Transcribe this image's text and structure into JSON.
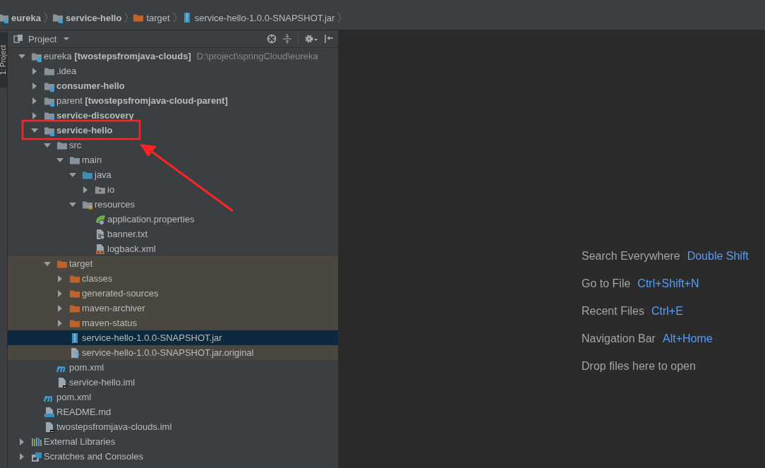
{
  "breadcrumbs": [
    {
      "label": "eureka",
      "kind": "module",
      "bold": true
    },
    {
      "label": "service-hello",
      "kind": "module",
      "bold": true
    },
    {
      "label": "target",
      "kind": "excluded-folder",
      "bold": false
    },
    {
      "label": "service-hello-1.0.0-SNAPSHOT.jar",
      "kind": "jar",
      "bold": false
    }
  ],
  "tool_stripe": {
    "label": "1: Project",
    "active": true
  },
  "project_panel": {
    "title": "Project",
    "tree": [
      {
        "label": "eureka **[twostepsfromjava-clouds]**",
        "path": "D:\\project\\springCloud\\eureka",
        "kind": "module",
        "bold": false,
        "expanded": true,
        "selected": false,
        "excluded": false,
        "children": [
          {
            "label": ".idea",
            "kind": "folder",
            "bold": false,
            "expanded": false,
            "selected": false,
            "excluded": false
          },
          {
            "label": "consumer-hello",
            "kind": "module",
            "bold": true,
            "expanded": false,
            "selected": false,
            "excluded": false
          },
          {
            "label": "parent **[twostepsfromjava-cloud-parent]**",
            "kind": "module",
            "bold": false,
            "expanded": false,
            "selected": false,
            "excluded": false
          },
          {
            "label": "service-discovery",
            "kind": "module",
            "bold": true,
            "expanded": false,
            "selected": false,
            "excluded": false
          },
          {
            "label": "service-hello",
            "kind": "module",
            "bold": true,
            "expanded": true,
            "selected": false,
            "excluded": false,
            "children": [
              {
                "label": "src",
                "kind": "folder",
                "bold": false,
                "expanded": true,
                "selected": false,
                "excluded": false,
                "children": [
                  {
                    "label": "main",
                    "kind": "folder",
                    "bold": false,
                    "expanded": true,
                    "selected": false,
                    "excluded": false,
                    "children": [
                      {
                        "label": "java",
                        "kind": "source-folder",
                        "bold": false,
                        "expanded": true,
                        "selected": false,
                        "excluded": false,
                        "children": [
                          {
                            "label": "io",
                            "kind": "package",
                            "bold": false,
                            "expanded": false,
                            "selected": false,
                            "excluded": false
                          }
                        ]
                      },
                      {
                        "label": "resources",
                        "kind": "resources-folder",
                        "bold": false,
                        "expanded": true,
                        "selected": false,
                        "excluded": false,
                        "children": [
                          {
                            "label": "application.properties",
                            "kind": "spring-file",
                            "bold": false,
                            "selected": false,
                            "excluded": false
                          },
                          {
                            "label": "banner.txt",
                            "kind": "text-file",
                            "bold": false,
                            "selected": false,
                            "excluded": false
                          },
                          {
                            "label": "logback.xml",
                            "kind": "xml-file",
                            "bold": false,
                            "selected": false,
                            "excluded": false
                          }
                        ]
                      }
                    ]
                  }
                ]
              },
              {
                "label": "target",
                "kind": "excluded-folder",
                "bold": false,
                "expanded": true,
                "selected": false,
                "excluded": true,
                "children": [
                  {
                    "label": "classes",
                    "kind": "excluded-folder",
                    "bold": false,
                    "expanded": false,
                    "selected": false,
                    "excluded": true
                  },
                  {
                    "label": "generated-sources",
                    "kind": "excluded-folder",
                    "bold": false,
                    "expanded": false,
                    "selected": false,
                    "excluded": true
                  },
                  {
                    "label": "maven-archiver",
                    "kind": "excluded-folder",
                    "bold": false,
                    "expanded": false,
                    "selected": false,
                    "excluded": true
                  },
                  {
                    "label": "maven-status",
                    "kind": "excluded-folder",
                    "bold": false,
                    "expanded": false,
                    "selected": false,
                    "excluded": true
                  },
                  {
                    "label": "service-hello-1.0.0-SNAPSHOT.jar",
                    "kind": "jar",
                    "bold": false,
                    "selected": true,
                    "excluded": false
                  },
                  {
                    "label": "service-hello-1.0.0-SNAPSHOT.jar.original",
                    "kind": "unknown-file",
                    "bold": false,
                    "selected": false,
                    "excluded": true
                  }
                ]
              },
              {
                "label": "pom.xml",
                "kind": "maven-file",
                "bold": false,
                "selected": false,
                "excluded": false
              },
              {
                "label": "service-hello.iml",
                "kind": "iml-file",
                "bold": false,
                "selected": false,
                "excluded": false
              }
            ]
          },
          {
            "label": "pom.xml",
            "kind": "maven-file",
            "bold": false,
            "selected": false,
            "excluded": false
          },
          {
            "label": "README.md",
            "kind": "markdown-file",
            "bold": false,
            "selected": false,
            "excluded": false
          },
          {
            "label": "twostepsfromjava-clouds.iml",
            "kind": "iml-file",
            "bold": false,
            "selected": false,
            "excluded": false
          }
        ]
      },
      {
        "label": "External Libraries",
        "kind": "libraries",
        "bold": false,
        "expanded": false,
        "selected": false,
        "excluded": false
      },
      {
        "label": "Scratches and Consoles",
        "kind": "scratches",
        "bold": false,
        "expanded": false,
        "selected": false,
        "excluded": false
      }
    ]
  },
  "editor_hints": [
    {
      "label": "Search Everywhere",
      "shortcut": "Double Shift"
    },
    {
      "label": "Go to File",
      "shortcut": "Ctrl+Shift+N"
    },
    {
      "label": "Recent Files",
      "shortcut": "Ctrl+E"
    },
    {
      "label": "Navigation Bar",
      "shortcut": "Alt+Home"
    },
    {
      "label": "Drop files here to open"
    }
  ]
}
